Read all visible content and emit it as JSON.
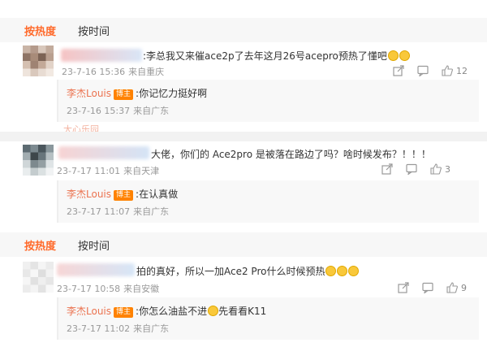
{
  "sort_tabs": {
    "hot": "按热度",
    "time": "按时间"
  },
  "comments": [
    {
      "text": ":李总我又来催ace2p了去年这月26号acepro预热了懂吧",
      "date": "23-7-16 15:36",
      "location": "来自重庆",
      "likes": "12",
      "reply": {
        "author": "李杰Louis",
        "badge": "博主",
        "text": ":你记忆力挺好啊",
        "date": "23-7-16 15:37",
        "location": "来自广东"
      }
    },
    {
      "text": "大佬，你们的 Ace2pro 是被落在路边了吗？啥时候发布？！！！",
      "date": "23-7-17 11:01",
      "location": "来自天津",
      "likes": "3",
      "reply": {
        "author": "李杰Louis",
        "badge": "博主",
        "text": ":在认真做",
        "date": "23-7-17 11:07",
        "location": "来自广东"
      }
    },
    {
      "text": "拍的真好，所以一加Ace2 Pro什么时候预热",
      "date": "23-7-17 10:58",
      "location": "来自安徽",
      "likes": "9",
      "reply": {
        "author": "李杰Louis",
        "badge": "博主",
        "text": ":你怎么油盐不进",
        "text2": "先看看K11",
        "date": "23-7-17 11:02",
        "location": "来自广东"
      }
    }
  ],
  "stray_text": "大心乐园"
}
